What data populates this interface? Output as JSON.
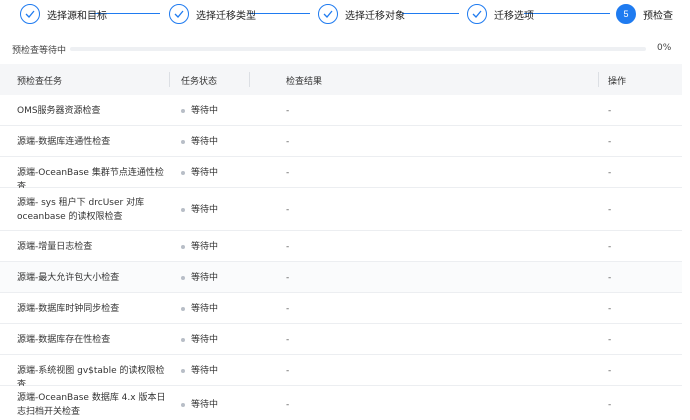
{
  "steps": [
    {
      "label": "选择源和目标",
      "done": true
    },
    {
      "label": "选择迁移类型",
      "done": true
    },
    {
      "label": "选择迁移对象",
      "done": true
    },
    {
      "label": "迁移选项",
      "done": true
    },
    {
      "label": "预检查",
      "number": "5",
      "active": true
    }
  ],
  "progress": {
    "label": "预检查等待中",
    "percent_text": "0%",
    "value": 0
  },
  "table": {
    "headers": {
      "task": "预检查任务",
      "status": "任务状态",
      "result": "检查结果",
      "action": "操作"
    },
    "rows": [
      {
        "task": "OMS服务器资源检查",
        "status": "等待中",
        "result": "-",
        "action": "-"
      },
      {
        "task": "源端-数据库连通性检查",
        "status": "等待中",
        "result": "-",
        "action": "-"
      },
      {
        "task": "源端-OceanBase 集群节点连通性检查",
        "status": "等待中",
        "result": "-",
        "action": "-"
      },
      {
        "task": "源端- sys 租户下 drcUser 对库 oceanbase 的读权限检查",
        "status": "等待中",
        "result": "-",
        "action": "-"
      },
      {
        "task": "源端-增量日志检查",
        "status": "等待中",
        "result": "-",
        "action": "-"
      },
      {
        "task": "源端-最大允许包大小检查",
        "status": "等待中",
        "result": "-",
        "action": "-"
      },
      {
        "task": "源端-数据库时钟同步检查",
        "status": "等待中",
        "result": "-",
        "action": "-"
      },
      {
        "task": "源端-数据库存在性检查",
        "status": "等待中",
        "result": "-",
        "action": "-"
      },
      {
        "task": "源端-系统视图 gv$table 的读权限检查",
        "status": "等待中",
        "result": "-",
        "action": "-"
      },
      {
        "task": "源端-OceanBase 数据库 4.x 版本日志扫档开关检查",
        "status": "等待中",
        "result": "-",
        "action": "-"
      }
    ]
  }
}
